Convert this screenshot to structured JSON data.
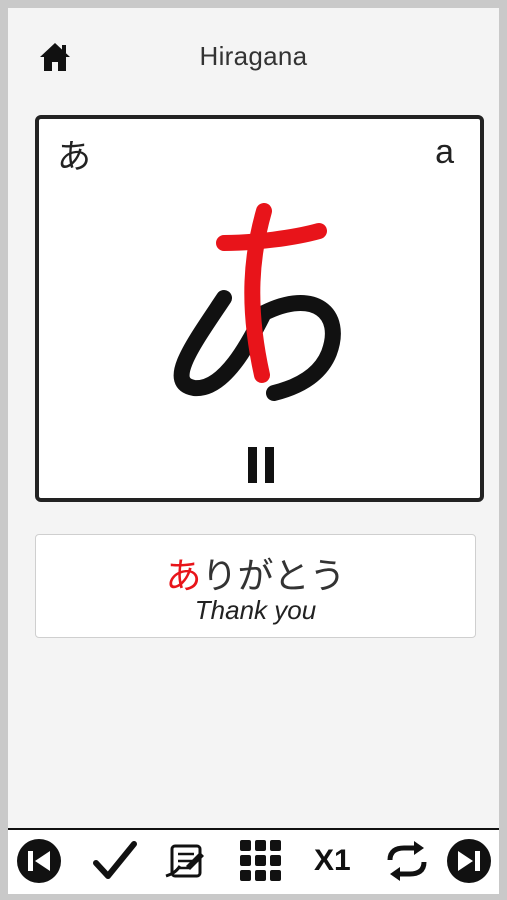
{
  "header": {
    "title": "Hiragana",
    "home_icon": "home-icon"
  },
  "card": {
    "kana": "あ",
    "romaji": "a",
    "glyph": "あ",
    "highlight_color": "#e8141a",
    "pause_icon": "pause-icon"
  },
  "example": {
    "highlighted": "あ",
    "rest": "りがとう",
    "meaning": "Thank you"
  },
  "toolbar": {
    "speed_label": "X1",
    "icons": [
      "previous-icon",
      "check-icon",
      "writing-practice-icon",
      "grid-icon",
      "repeat-icon",
      "next-icon"
    ]
  }
}
